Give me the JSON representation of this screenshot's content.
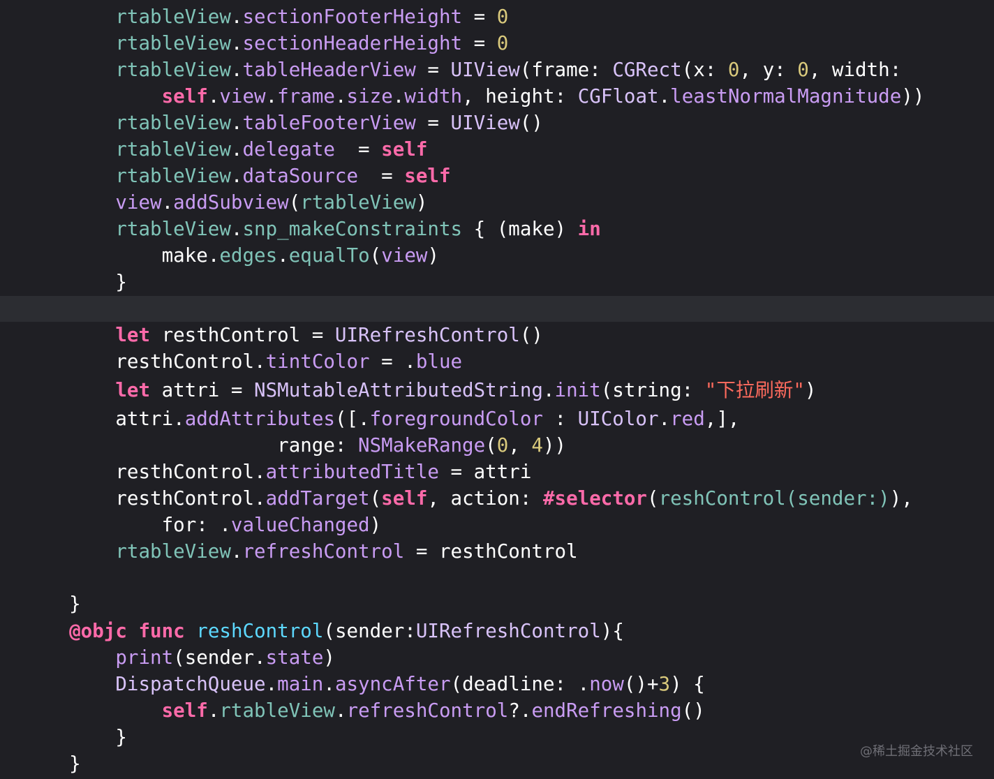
{
  "editor": {
    "theme_colors": {
      "background": "#1f1f24",
      "current_line": "#2c2d32",
      "plain": "#ffffff",
      "project_identifier": "#80c4b8",
      "system_method": "#c99cf3",
      "system_type": "#d8c2f8",
      "keyword": "#fc6aa9",
      "number": "#d9c97c",
      "string": "#fc6a5d",
      "declaration": "#5dd8ff"
    },
    "lines": [
      {
        "indent": "      ",
        "current": false,
        "tokens": [
          {
            "t": "rtableView",
            "c": "prop"
          },
          {
            "t": ".",
            "c": "plain"
          },
          {
            "t": "sectionFooterHeight",
            "c": "method"
          },
          {
            "t": " = ",
            "c": "plain"
          },
          {
            "t": "0",
            "c": "num"
          }
        ]
      },
      {
        "indent": "      ",
        "current": false,
        "tokens": [
          {
            "t": "rtableView",
            "c": "prop"
          },
          {
            "t": ".",
            "c": "plain"
          },
          {
            "t": "sectionHeaderHeight",
            "c": "method"
          },
          {
            "t": " = ",
            "c": "plain"
          },
          {
            "t": "0",
            "c": "num"
          }
        ]
      },
      {
        "indent": "      ",
        "current": false,
        "tokens": [
          {
            "t": "rtableView",
            "c": "prop"
          },
          {
            "t": ".",
            "c": "plain"
          },
          {
            "t": "tableHeaderView",
            "c": "method"
          },
          {
            "t": " = ",
            "c": "plain"
          },
          {
            "t": "UIView",
            "c": "type"
          },
          {
            "t": "(frame: ",
            "c": "plain"
          },
          {
            "t": "CGRect",
            "c": "type"
          },
          {
            "t": "(x: ",
            "c": "plain"
          },
          {
            "t": "0",
            "c": "num"
          },
          {
            "t": ", y: ",
            "c": "plain"
          },
          {
            "t": "0",
            "c": "num"
          },
          {
            "t": ", width:",
            "c": "plain"
          }
        ]
      },
      {
        "indent": "          ",
        "current": false,
        "tokens": [
          {
            "t": "self",
            "c": "kw"
          },
          {
            "t": ".",
            "c": "plain"
          },
          {
            "t": "view",
            "c": "method"
          },
          {
            "t": ".",
            "c": "plain"
          },
          {
            "t": "frame",
            "c": "method"
          },
          {
            "t": ".",
            "c": "plain"
          },
          {
            "t": "size",
            "c": "method"
          },
          {
            "t": ".",
            "c": "plain"
          },
          {
            "t": "width",
            "c": "method"
          },
          {
            "t": ", height: ",
            "c": "plain"
          },
          {
            "t": "CGFloat",
            "c": "type"
          },
          {
            "t": ".",
            "c": "plain"
          },
          {
            "t": "leastNormalMagnitude",
            "c": "method"
          },
          {
            "t": "))",
            "c": "plain"
          }
        ]
      },
      {
        "indent": "      ",
        "current": false,
        "tokens": [
          {
            "t": "rtableView",
            "c": "prop"
          },
          {
            "t": ".",
            "c": "plain"
          },
          {
            "t": "tableFooterView",
            "c": "method"
          },
          {
            "t": " = ",
            "c": "plain"
          },
          {
            "t": "UIView",
            "c": "type"
          },
          {
            "t": "()",
            "c": "plain"
          }
        ]
      },
      {
        "indent": "      ",
        "current": false,
        "tokens": [
          {
            "t": "rtableView",
            "c": "prop"
          },
          {
            "t": ".",
            "c": "plain"
          },
          {
            "t": "delegate",
            "c": "method"
          },
          {
            "t": "  = ",
            "c": "plain"
          },
          {
            "t": "self",
            "c": "kw"
          }
        ]
      },
      {
        "indent": "      ",
        "current": false,
        "tokens": [
          {
            "t": "rtableView",
            "c": "prop"
          },
          {
            "t": ".",
            "c": "plain"
          },
          {
            "t": "dataSource",
            "c": "method"
          },
          {
            "t": "  = ",
            "c": "plain"
          },
          {
            "t": "self",
            "c": "kw"
          }
        ]
      },
      {
        "indent": "      ",
        "current": false,
        "tokens": [
          {
            "t": "view",
            "c": "method"
          },
          {
            "t": ".",
            "c": "plain"
          },
          {
            "t": "addSubview",
            "c": "method"
          },
          {
            "t": "(",
            "c": "plain"
          },
          {
            "t": "rtableView",
            "c": "prop"
          },
          {
            "t": ")",
            "c": "plain"
          }
        ]
      },
      {
        "indent": "      ",
        "current": false,
        "tokens": [
          {
            "t": "rtableView",
            "c": "prop"
          },
          {
            "t": ".",
            "c": "plain"
          },
          {
            "t": "snp_makeConstraints",
            "c": "prop"
          },
          {
            "t": " { (make) ",
            "c": "plain"
          },
          {
            "t": "in",
            "c": "kw"
          }
        ]
      },
      {
        "indent": "          ",
        "current": false,
        "tokens": [
          {
            "t": "make",
            "c": "plain"
          },
          {
            "t": ".",
            "c": "plain"
          },
          {
            "t": "edges",
            "c": "prop"
          },
          {
            "t": ".",
            "c": "plain"
          },
          {
            "t": "equalTo",
            "c": "prop"
          },
          {
            "t": "(",
            "c": "plain"
          },
          {
            "t": "view",
            "c": "method"
          },
          {
            "t": ")",
            "c": "plain"
          }
        ]
      },
      {
        "indent": "      ",
        "current": false,
        "tokens": [
          {
            "t": "}",
            "c": "plain"
          }
        ]
      },
      {
        "indent": "",
        "current": true,
        "tokens": []
      },
      {
        "indent": "      ",
        "current": false,
        "tokens": [
          {
            "t": "let",
            "c": "kw"
          },
          {
            "t": " resthControl = ",
            "c": "plain"
          },
          {
            "t": "UIRefreshControl",
            "c": "type"
          },
          {
            "t": "()",
            "c": "plain"
          }
        ]
      },
      {
        "indent": "      ",
        "current": false,
        "tokens": [
          {
            "t": "resthControl",
            "c": "plain"
          },
          {
            "t": ".",
            "c": "plain"
          },
          {
            "t": "tintColor",
            "c": "method"
          },
          {
            "t": " = .",
            "c": "plain"
          },
          {
            "t": "blue",
            "c": "method"
          }
        ]
      },
      {
        "indent": "      ",
        "current": false,
        "tokens": [
          {
            "t": "let",
            "c": "kw"
          },
          {
            "t": " attri = ",
            "c": "plain"
          },
          {
            "t": "NSMutableAttributedString",
            "c": "type"
          },
          {
            "t": ".",
            "c": "plain"
          },
          {
            "t": "init",
            "c": "method"
          },
          {
            "t": "(string: ",
            "c": "plain"
          },
          {
            "t": "\"下拉刷新\"",
            "c": "str"
          },
          {
            "t": ")",
            "c": "plain"
          }
        ]
      },
      {
        "indent": "      ",
        "current": false,
        "tokens": [
          {
            "t": "attri",
            "c": "plain"
          },
          {
            "t": ".",
            "c": "plain"
          },
          {
            "t": "addAttributes",
            "c": "method"
          },
          {
            "t": "([.",
            "c": "plain"
          },
          {
            "t": "foregroundColor",
            "c": "method"
          },
          {
            "t": " : ",
            "c": "plain"
          },
          {
            "t": "UIColor",
            "c": "type"
          },
          {
            "t": ".",
            "c": "plain"
          },
          {
            "t": "red",
            "c": "method"
          },
          {
            "t": ",],",
            "c": "plain"
          }
        ]
      },
      {
        "indent": "                    ",
        "current": false,
        "tokens": [
          {
            "t": "range: ",
            "c": "plain"
          },
          {
            "t": "NSMakeRange",
            "c": "method"
          },
          {
            "t": "(",
            "c": "plain"
          },
          {
            "t": "0",
            "c": "num"
          },
          {
            "t": ", ",
            "c": "plain"
          },
          {
            "t": "4",
            "c": "num"
          },
          {
            "t": "))",
            "c": "plain"
          }
        ]
      },
      {
        "indent": "      ",
        "current": false,
        "tokens": [
          {
            "t": "resthControl",
            "c": "plain"
          },
          {
            "t": ".",
            "c": "plain"
          },
          {
            "t": "attributedTitle",
            "c": "method"
          },
          {
            "t": " = attri",
            "c": "plain"
          }
        ]
      },
      {
        "indent": "      ",
        "current": false,
        "tokens": [
          {
            "t": "resthControl",
            "c": "plain"
          },
          {
            "t": ".",
            "c": "plain"
          },
          {
            "t": "addTarget",
            "c": "method"
          },
          {
            "t": "(",
            "c": "plain"
          },
          {
            "t": "self",
            "c": "kw"
          },
          {
            "t": ", action: ",
            "c": "plain"
          },
          {
            "t": "#selector",
            "c": "kw"
          },
          {
            "t": "(",
            "c": "plain"
          },
          {
            "t": "reshControl(sender:)",
            "c": "prop"
          },
          {
            "t": "),",
            "c": "plain"
          }
        ]
      },
      {
        "indent": "          ",
        "current": false,
        "tokens": [
          {
            "t": "for: .",
            "c": "plain"
          },
          {
            "t": "valueChanged",
            "c": "method"
          },
          {
            "t": ")",
            "c": "plain"
          }
        ]
      },
      {
        "indent": "      ",
        "current": false,
        "tokens": [
          {
            "t": "rtableView",
            "c": "prop"
          },
          {
            "t": ".",
            "c": "plain"
          },
          {
            "t": "refreshControl",
            "c": "method"
          },
          {
            "t": " = resthControl",
            "c": "plain"
          }
        ]
      },
      {
        "indent": "",
        "current": false,
        "tokens": []
      },
      {
        "indent": "  ",
        "current": false,
        "tokens": [
          {
            "t": "}",
            "c": "plain"
          }
        ]
      },
      {
        "indent": "  ",
        "current": false,
        "tokens": [
          {
            "t": "@objc",
            "c": "kw"
          },
          {
            "t": " ",
            "c": "plain"
          },
          {
            "t": "func",
            "c": "kw"
          },
          {
            "t": " ",
            "c": "plain"
          },
          {
            "t": "reshControl",
            "c": "decl"
          },
          {
            "t": "(sender:",
            "c": "plain"
          },
          {
            "t": "UIRefreshControl",
            "c": "type"
          },
          {
            "t": "){",
            "c": "plain"
          }
        ]
      },
      {
        "indent": "      ",
        "current": false,
        "tokens": [
          {
            "t": "print",
            "c": "method"
          },
          {
            "t": "(sender.",
            "c": "plain"
          },
          {
            "t": "state",
            "c": "method"
          },
          {
            "t": ")",
            "c": "plain"
          }
        ]
      },
      {
        "indent": "      ",
        "current": false,
        "tokens": [
          {
            "t": "DispatchQueue",
            "c": "type"
          },
          {
            "t": ".",
            "c": "plain"
          },
          {
            "t": "main",
            "c": "method"
          },
          {
            "t": ".",
            "c": "plain"
          },
          {
            "t": "asyncAfter",
            "c": "method"
          },
          {
            "t": "(deadline: .",
            "c": "plain"
          },
          {
            "t": "now",
            "c": "method"
          },
          {
            "t": "()+",
            "c": "plain"
          },
          {
            "t": "3",
            "c": "num"
          },
          {
            "t": ") {",
            "c": "plain"
          }
        ]
      },
      {
        "indent": "          ",
        "current": false,
        "tokens": [
          {
            "t": "self",
            "c": "kw"
          },
          {
            "t": ".",
            "c": "plain"
          },
          {
            "t": "rtableView",
            "c": "prop"
          },
          {
            "t": ".",
            "c": "plain"
          },
          {
            "t": "refreshControl",
            "c": "method"
          },
          {
            "t": "?.",
            "c": "plain"
          },
          {
            "t": "endRefreshing",
            "c": "method"
          },
          {
            "t": "()",
            "c": "plain"
          }
        ]
      },
      {
        "indent": "      ",
        "current": false,
        "tokens": [
          {
            "t": "}",
            "c": "plain"
          }
        ]
      },
      {
        "indent": "  ",
        "current": false,
        "tokens": [
          {
            "t": "}",
            "c": "plain"
          }
        ]
      }
    ]
  },
  "watermark": "@稀土掘金技术社区"
}
